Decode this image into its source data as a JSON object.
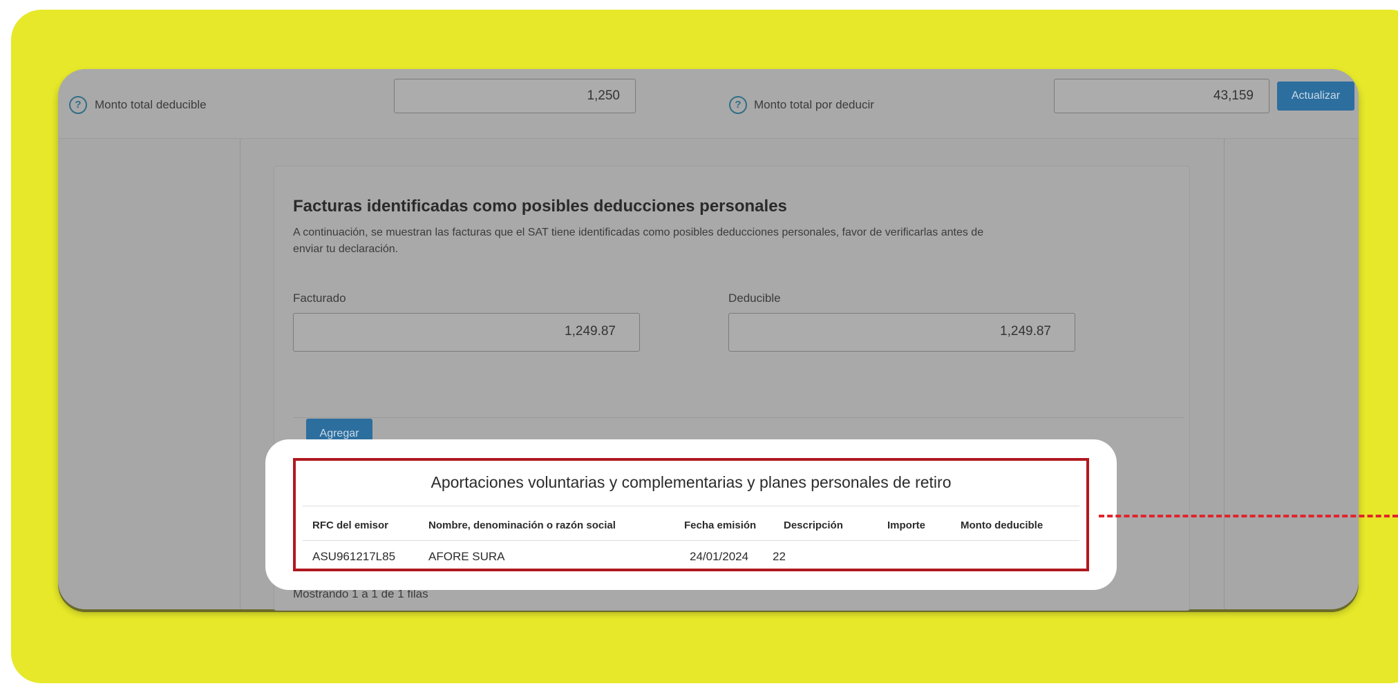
{
  "summary": {
    "deductible_label": "Monto total deducible",
    "deductible_value": "1,250",
    "pending_label": "Monto total por deducir",
    "pending_value": "43,159",
    "update_button": "Actualizar"
  },
  "section": {
    "title": "Facturas identificadas como posibles deducciones personales",
    "description": "A continuación, se muestran las facturas que el SAT tiene identificadas como posibles deducciones personales, favor de verificarlas antes de enviar tu declaración.",
    "billed_label": "Facturado",
    "billed_value": "1,249.87",
    "deductible_label": "Deducible",
    "deductible_value": "1,249.87",
    "add_button": "Agregar"
  },
  "table": {
    "title": "Aportaciones voluntarias y complementarias y planes personales de retiro",
    "headers": [
      "RFC del emisor",
      "Nombre, denominación o razón social",
      "Fecha emisión",
      "Descripción",
      "Importe",
      "Monto deducible"
    ],
    "rows": [
      [
        "ASU961217L85",
        "AFORE SURA",
        "24/01/2024",
        "22",
        "",
        ""
      ]
    ],
    "footer": "Mostrando 1 a 1 de 1 filas"
  },
  "colors": {
    "background_yellow": "#e6e829",
    "highlight_red": "#b0191f",
    "dash_red": "#e2242b",
    "button_blue": "#2c6e9e"
  }
}
